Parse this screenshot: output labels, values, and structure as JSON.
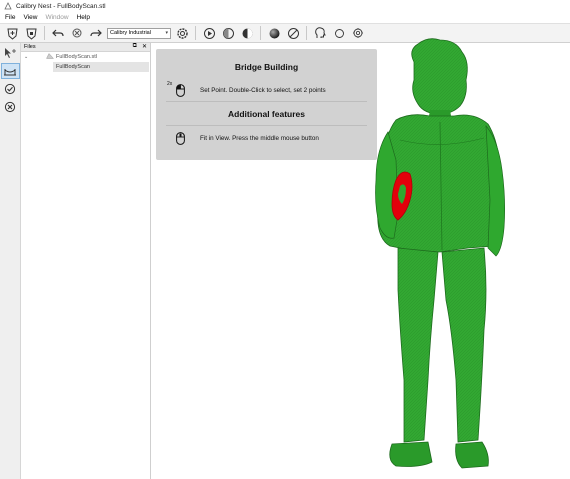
{
  "window": {
    "title": "Calibry Nest - FullBodyScan.stl"
  },
  "menu": [
    {
      "label": "File",
      "enabled": true
    },
    {
      "label": "View",
      "enabled": true
    },
    {
      "label": "Window",
      "enabled": false
    },
    {
      "label": "Help",
      "enabled": true
    }
  ],
  "toolbar": {
    "device_select": "Calibry Industrial",
    "icons": [
      "open-scan-icon",
      "save-scan-icon",
      "undo-icon",
      "cancel-icon",
      "redo-icon",
      "settings-icon",
      "play-icon",
      "shading-icon",
      "contrast-icon",
      "sphere-icon",
      "no-texture-icon",
      "head-profile-icon",
      "circle-icon",
      "brightness-icon"
    ]
  },
  "left_toolbar": {
    "icons": [
      "select-cursor-icon",
      "bridge-tool-icon",
      "check-icon",
      "cancel-icon"
    ]
  },
  "files_panel": {
    "title": "Files",
    "parent_label": "FullBodyScan.stl",
    "child_label": "FullBodyScan"
  },
  "info_box": {
    "heading1": "Bridge Building",
    "row1_badge": "2x",
    "row1_text": "Set Point. Double-Click to select, set 2 points",
    "heading2": "Additional features",
    "row2_text": "Fit in View. Press the middle mouse button"
  },
  "colors": {
    "model_green": "#2fa82f",
    "model_dark": "#1d6b1d",
    "selection_red": "#e3000b",
    "toolbar_bg": "#f3f3f3",
    "active_tool": "#cfe3f5"
  }
}
